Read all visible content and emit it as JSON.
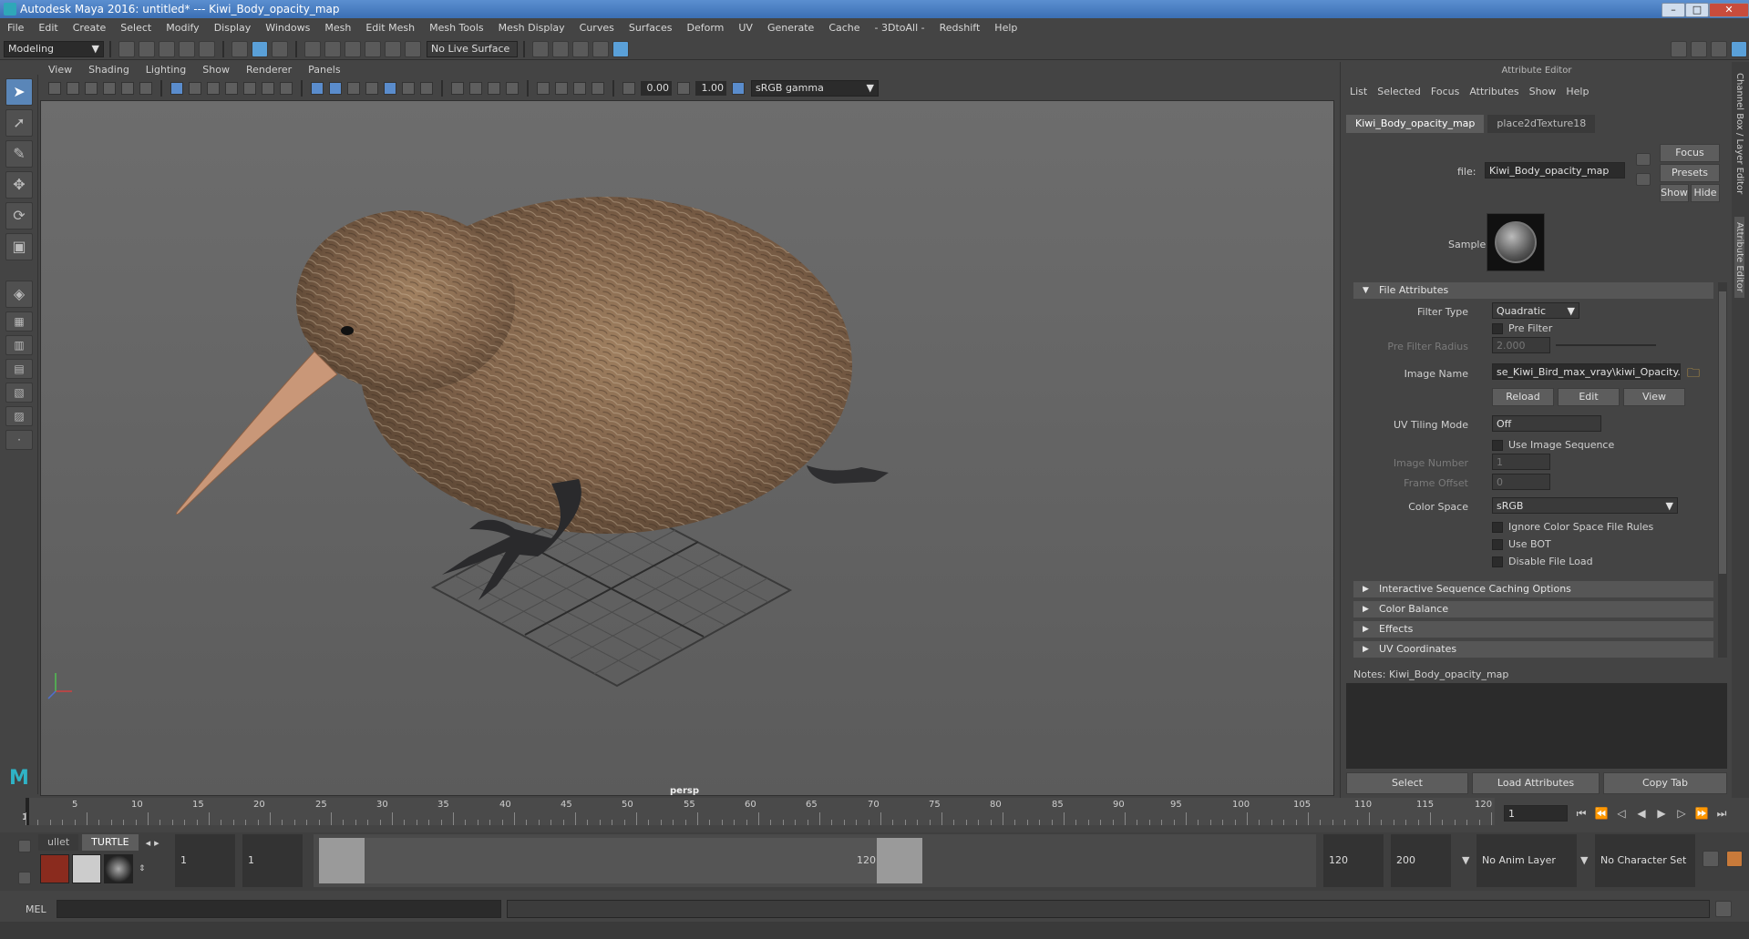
{
  "window": {
    "title": "Autodesk Maya 2016: untitled*   ---   Kiwi_Body_opacity_map",
    "min_label": "–",
    "max_label": "□",
    "close_label": "✕"
  },
  "menubar": [
    "File",
    "Edit",
    "Create",
    "Select",
    "Modify",
    "Display",
    "Windows",
    "Mesh",
    "Edit Mesh",
    "Mesh Tools",
    "Mesh Display",
    "Curves",
    "Surfaces",
    "Deform",
    "UV",
    "Generate",
    "Cache",
    "- 3DtoAll -",
    "Redshift",
    "Help"
  ],
  "statusline": {
    "mode": "Modeling",
    "live_surface": "No Live Surface"
  },
  "viewport": {
    "menu": [
      "View",
      "Shading",
      "Lighting",
      "Show",
      "Renderer",
      "Panels"
    ],
    "exposure": "0.00",
    "gamma": "1.00",
    "colorspace": "sRGB gamma",
    "camera": "persp"
  },
  "attribute_editor": {
    "title": "Attribute Editor",
    "menu": [
      "List",
      "Selected",
      "Focus",
      "Attributes",
      "Show",
      "Help"
    ],
    "tabs": [
      "Kiwi_Body_opacity_map",
      "place2dTexture18"
    ],
    "file_label": "file:",
    "file_value": "Kiwi_Body_opacity_map",
    "buttons": {
      "focus": "Focus",
      "presets": "Presets",
      "show": "Show",
      "hide": "Hide"
    },
    "sample_label": "Sample",
    "section_file": "File Attributes",
    "filter_type_label": "Filter Type",
    "filter_type_value": "Quadratic",
    "pre_filter_label": "Pre Filter",
    "pre_filter_radius_label": "Pre Filter Radius",
    "pre_filter_radius_value": "2.000",
    "image_name_label": "Image Name",
    "image_name_value": "se_Kiwi_Bird_max_vray\\kiwi_Opacity.png",
    "reload": "Reload",
    "edit": "Edit",
    "view": "View",
    "uv_tiling_label": "UV Tiling Mode",
    "uv_tiling_value": "Off",
    "use_image_seq": "Use Image Sequence",
    "image_number_label": "Image Number",
    "image_number_value": "1",
    "frame_offset_label": "Frame Offset",
    "frame_offset_value": "0",
    "color_space_label": "Color Space",
    "color_space_value": "sRGB",
    "ignore_cs": "Ignore Color Space File Rules",
    "use_bot": "Use BOT",
    "disable_load": "Disable File Load",
    "sections_collapsed": [
      "Interactive Sequence Caching Options",
      "Color Balance",
      "Effects",
      "UV Coordinates"
    ],
    "notes_label": "Notes:  Kiwi_Body_opacity_map",
    "bottom_buttons": [
      "Select",
      "Load Attributes",
      "Copy Tab"
    ]
  },
  "side_tabs": [
    "Channel Box / Layer Editor",
    "Attribute Editor"
  ],
  "timeline": {
    "ticks": [
      "5",
      "10",
      "15",
      "20",
      "25",
      "30",
      "35",
      "40",
      "45",
      "50",
      "55",
      "60",
      "65",
      "70",
      "75",
      "80",
      "85",
      "90",
      "95",
      "100",
      "105",
      "110",
      "115",
      "120"
    ],
    "start_marker": "1",
    "current_frame": "1"
  },
  "range": {
    "shelf_tabs": [
      "ullet",
      "TURTLE"
    ],
    "start": "1",
    "inner_start": "1",
    "range_start_label": "1",
    "range_end_label": "120",
    "end": "120",
    "outer_end": "200",
    "anim_layer": "No Anim Layer",
    "character_set": "No Character Set"
  },
  "cmdline": {
    "mel_label": "MEL"
  }
}
